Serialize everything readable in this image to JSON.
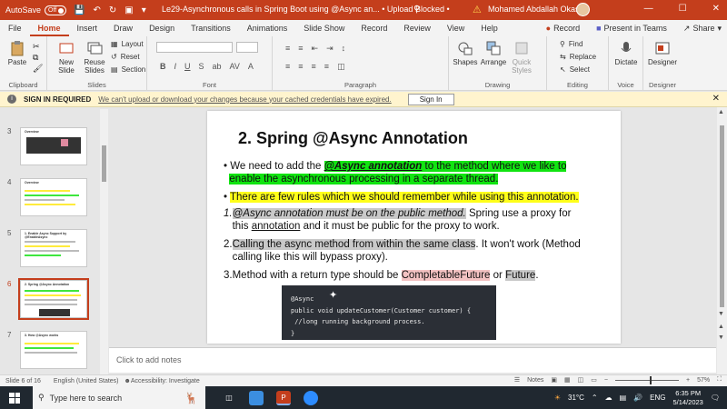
{
  "titlebar": {
    "autosave": "AutoSave",
    "toggle": "Off",
    "title": "Le29-Asynchronous calls in Spring Boot using @Async an... • Upload Blocked •",
    "search_icon": "search-icon",
    "user": "Mohamed Abdallah Okasha"
  },
  "tabs": [
    "File",
    "Home",
    "Insert",
    "Draw",
    "Design",
    "Transitions",
    "Animations",
    "Slide Show",
    "Record",
    "Review",
    "View",
    "Help"
  ],
  "active_tab": "Home",
  "tab_right": {
    "record": "Record",
    "present": "Present in Teams",
    "share": "Share"
  },
  "ribbon": {
    "paste": "Paste",
    "clipboard": "Clipboard",
    "new_slide": "New Slide",
    "reuse_slides": "Reuse Slides",
    "layout": "Layout",
    "reset": "Reset",
    "section": "Section",
    "slides": "Slides",
    "font": "Font",
    "paragraph": "Paragraph",
    "shapes": "Shapes",
    "arrange": "Arrange",
    "quick_styles": "Quick Styles",
    "drawing": "Drawing",
    "find": "Find",
    "replace": "Replace",
    "select": "Select",
    "editing": "Editing",
    "dictate": "Dictate",
    "voice": "Voice",
    "designer": "Designer"
  },
  "infobar": {
    "label": "SIGN IN REQUIRED",
    "message": "We can't upload or download your changes because your cached credentials have expired.",
    "button": "Sign In"
  },
  "thumbnails": [
    {
      "num": "3",
      "title": "Overview"
    },
    {
      "num": "4",
      "title": "Overview"
    },
    {
      "num": "5",
      "title": "1. Enable Async Support by @EnableAsync"
    },
    {
      "num": "6",
      "title": "2. Spring @Async Annotation"
    },
    {
      "num": "7",
      "title": "3. How @Async works"
    }
  ],
  "slide": {
    "title": "2. Spring @Async Annotation",
    "b1_pre": "We need to add the ",
    "b1_hl": "@Async annotation",
    "b1_post": " to the method where we like to",
    "b1_line2": "enable the asynchronous processing in a separate thread.",
    "b2": "There are few rules which we should remember while using this annotation.",
    "n1_num": "1.",
    "n1_hl": "@Async annotation must be on the public method.",
    "n1_rest": " Spring use a proxy for",
    "n1_line2_pre": "this ",
    "n1_line2_ul": "annotation",
    "n1_line2_post": " and it must be public for the proxy to work.",
    "n2_num": "2.",
    "n2_hl": "Calling the async method from within the same class",
    "n2_rest": ". It won't work (Method",
    "n2_line2": "calling like this will bypass proxy).",
    "n3_num": "3.",
    "n3_pre": "Method with a return type should be ",
    "n3_hl1": "CompletableFuture",
    "n3_mid": " or ",
    "n3_hl2": "Future",
    "n3_end": ".",
    "code": [
      "@Async",
      "public void updateCustomer(Customer customer) {",
      " //long running background process.",
      "}"
    ]
  },
  "notes_placeholder": "Click to add notes",
  "status": {
    "slide": "Slide 6 of 16",
    "language": "English (United States)",
    "accessibility": "Accessibility: Investigate",
    "notes": "Notes",
    "zoom": "57%"
  },
  "taskbar": {
    "search": "Type here to search",
    "weather": "31°C",
    "lang": "ENG",
    "time": "6:35 PM",
    "date": "5/14/2023"
  },
  "colors": {
    "accent": "#c43e1c",
    "green_highlight": "#11e411",
    "yellow_highlight": "#ffff1a"
  }
}
